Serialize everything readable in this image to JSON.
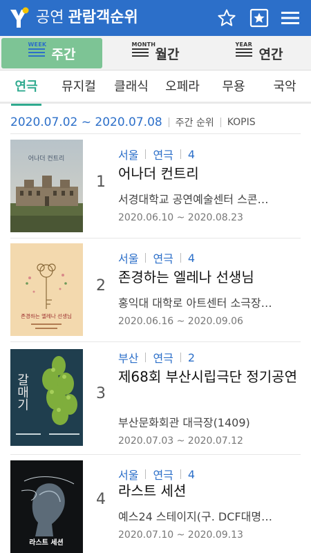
{
  "header": {
    "title_light": "공연",
    "title_bold": "관람객순위",
    "logo_icon": "yes24-y-logo-icon",
    "star_icon": "star-outline-icon",
    "favorites_icon": "star-box-icon",
    "menu_icon": "hamburger-menu-icon"
  },
  "period_tabs": [
    {
      "tag": "WEEK",
      "label": "주간",
      "active": true
    },
    {
      "tag": "MONTH",
      "label": "월간",
      "active": false
    },
    {
      "tag": "YEAR",
      "label": "연간",
      "active": false
    }
  ],
  "genre_tabs": [
    {
      "label": "연극",
      "active": true
    },
    {
      "label": "뮤지컬",
      "active": false
    },
    {
      "label": "클래식",
      "active": false
    },
    {
      "label": "오페라",
      "active": false
    },
    {
      "label": "무용",
      "active": false
    },
    {
      "label": "국악",
      "active": false
    }
  ],
  "info": {
    "date_range": "2020.07.02 ~ 2020.07.08",
    "ranking_type": "주간 순위",
    "source": "KOPIS"
  },
  "items": [
    {
      "rank": "1",
      "region": "서울",
      "genre": "연극",
      "count": "4",
      "title": "어나더 컨트리",
      "venue": "서경대학교 공연예술센터 스콘…",
      "dates": "2020.06.10 ~ 2020.08.23"
    },
    {
      "rank": "2",
      "region": "서울",
      "genre": "연극",
      "count": "4",
      "title": "존경하는 엘레나 선생님",
      "venue": "홍익대 대학로 아트센터 소극장…",
      "dates": "2020.06.16 ~ 2020.09.06"
    },
    {
      "rank": "3",
      "region": "부산",
      "genre": "연극",
      "count": "2",
      "title": "제68회 부산시립극단 정기공연",
      "venue": "부산문화회관 대극장(1409)",
      "dates": "2020.07.03 ~ 2020.07.12"
    },
    {
      "rank": "4",
      "region": "서울",
      "genre": "연극",
      "count": "4",
      "title": "라스트 세션",
      "venue": "예스24 스테이지(구. DCF대명…",
      "dates": "2020.07.10 ~ 2020.09.13"
    }
  ],
  "poster_text": [
    "어나더 컨트리",
    "존경하는 엘레나 선생님",
    "갈매기",
    "라스트 세션"
  ],
  "colors": {
    "header_bg": "#2c6fc9",
    "active_period": "#7dc495",
    "active_genre": "#2faa8f",
    "meta_blue": "#2c6fc9"
  }
}
